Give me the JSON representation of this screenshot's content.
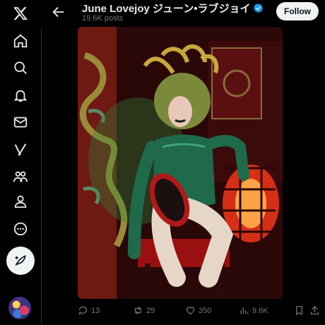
{
  "header": {
    "display_name": "June Lovejoy ジューン•ラブジョイ",
    "post_count": "19.6K posts",
    "follow_label": "Follow"
  },
  "nav": {
    "items": [
      "x-logo-icon",
      "home-icon",
      "search-icon",
      "notifications-icon",
      "messages-icon",
      "grok-icon",
      "communities-icon",
      "profile-icon",
      "more-icon"
    ]
  },
  "media": {
    "alt": "Cosplay photo of a woman dressed as Medusa in green latex"
  },
  "actions": {
    "replies": "13",
    "reposts": "29",
    "likes": "350",
    "views": "9.6K"
  },
  "colors": {
    "accent": "#1d9bf0",
    "muted": "#71767b",
    "background": "#000000"
  }
}
